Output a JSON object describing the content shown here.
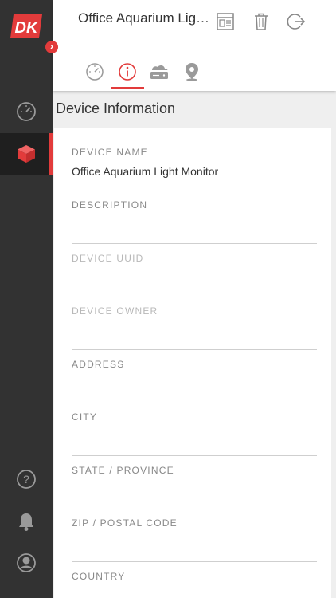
{
  "app": {
    "logo_text": "DK"
  },
  "header": {
    "title": "Office Aquarium Light Monitor"
  },
  "icons": {
    "header": [
      "dashboard-layout-icon",
      "trash-icon",
      "logout-icon"
    ],
    "tabs": [
      "speedometer-icon",
      "info-icon",
      "storage-icon",
      "location-pin-icon"
    ],
    "sidebar": [
      "speedometer-icon",
      "cube-icon",
      "help-icon",
      "bell-icon",
      "user-icon"
    ]
  },
  "colors": {
    "accent": "#e23b3b",
    "sidebar_bg": "#323232",
    "sidebar_active": "#1f1f1f"
  },
  "section": {
    "title": "Device Information"
  },
  "fields": [
    {
      "label": "DEVICE NAME",
      "value": "Office Aquarium Light Monitor",
      "disabled": false
    },
    {
      "label": "DESCRIPTION",
      "value": "",
      "disabled": false
    },
    {
      "label": "DEVICE UUID",
      "value": "",
      "disabled": true
    },
    {
      "label": "DEVICE OWNER",
      "value": "",
      "disabled": true
    },
    {
      "label": "ADDRESS",
      "value": "",
      "disabled": false
    },
    {
      "label": "CITY",
      "value": "",
      "disabled": false
    },
    {
      "label": "STATE / PROVINCE",
      "value": "",
      "disabled": false
    },
    {
      "label": "ZIP / POSTAL CODE",
      "value": "",
      "disabled": false
    },
    {
      "label": "COUNTRY",
      "value": "",
      "disabled": false
    }
  ]
}
